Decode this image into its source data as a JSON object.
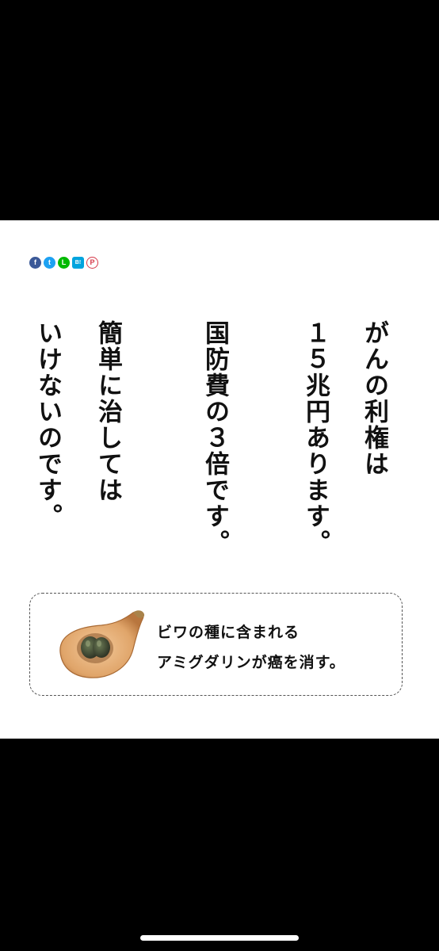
{
  "share_buttons": [
    {
      "name": "facebook",
      "glyph": "f",
      "color": "#3b5998"
    },
    {
      "name": "twitter",
      "glyph": "t",
      "color": "#1da1f2"
    },
    {
      "name": "line",
      "glyph": "L",
      "color": "#00b900"
    },
    {
      "name": "hatena-bookmark",
      "glyph": "B!",
      "color": "#00a4de"
    },
    {
      "name": "pinterest",
      "glyph": "P",
      "color": "#d63a4a"
    }
  ],
  "article": {
    "columns": [
      "がんの利権は",
      "１５兆円あります。",
      "国防費の３倍です。",
      "簡単に治しては",
      "いけないのです。"
    ]
  },
  "callout": {
    "image": "loquat-with-seed",
    "line1": "ビワの種に含まれる",
    "line2": "アミグダリンが癌を消す。"
  }
}
